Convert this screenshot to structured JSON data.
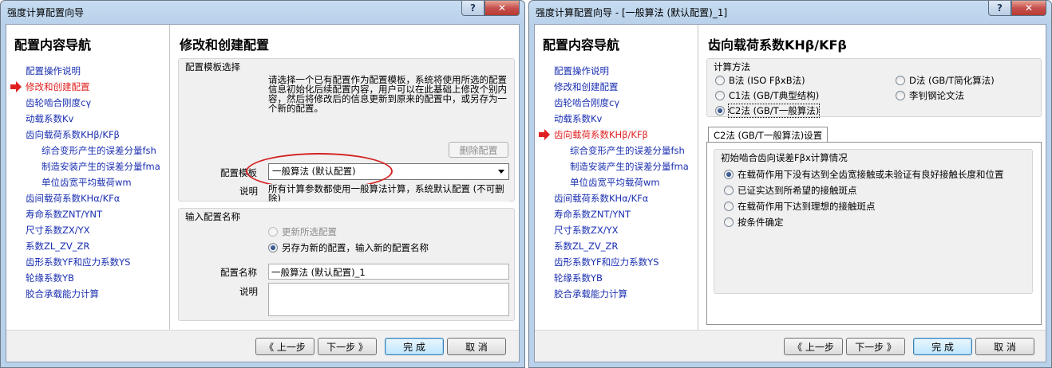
{
  "left_window": {
    "title": "强度计算配置向导",
    "nav_title": "配置内容导航",
    "nav_items": [
      {
        "label": "配置操作说明"
      },
      {
        "label": "修改和创建配置"
      },
      {
        "label": "齿轮啮合刚度cγ"
      },
      {
        "label": "动载系数Kv"
      },
      {
        "label": "齿向载荷系数KHβ/KFβ"
      },
      {
        "label": "综合变形产生的误差分量fsh"
      },
      {
        "label": "制造安装产生的误差分量fma"
      },
      {
        "label": "单位齿宽平均载荷wm"
      },
      {
        "label": "齿间载荷系数KHα/KFα"
      },
      {
        "label": "寿命系数ZNT/YNT"
      },
      {
        "label": "尺寸系数ZX/YX"
      },
      {
        "label": "系数ZL_ZV_ZR"
      },
      {
        "label": "齿形系数YF和应力系数YS"
      },
      {
        "label": "轮缘系数YB"
      },
      {
        "label": "胶合承载能力计算"
      }
    ],
    "main_title": "修改和创建配置",
    "template_group": {
      "title": "配置模板选择",
      "description": "请选择一个已有配置作为配置模板，系统将使用所选的配置信息初始化后续配置内容，用户可以在此基础上修改个别内容，然后将修改后的信息更新到原来的配置中，或另存为一个新的配置。",
      "delete_button": "删除配置",
      "template_label": "配置模板",
      "template_value": "一般算法  (默认配置)",
      "note_label": "说明",
      "note_value": "所有计算参数都使用一般算法计算，系统默认配置 (不可删除)"
    },
    "name_group": {
      "title": "输入配置名称",
      "option_update": "更新所选配置",
      "option_save_as": "另存为新的配置，输入新的配置名称",
      "name_label": "配置名称",
      "name_value": "一般算法  (默认配置)_1",
      "note_label": "说明",
      "note_value": ""
    },
    "buttons": {
      "prev": "《 上一步",
      "next": "下一步 》",
      "finish": "完 成",
      "cancel": "取 消"
    }
  },
  "right_window": {
    "title": "强度计算配置向导 - [一般算法 (默认配置)_1]",
    "nav_title": "配置内容导航",
    "nav_items": [
      {
        "label": "配置操作说明"
      },
      {
        "label": "修改和创建配置"
      },
      {
        "label": "齿轮啮合刚度cγ"
      },
      {
        "label": "动载系数Kv"
      },
      {
        "label": "齿向载荷系数KHβ/KFβ"
      },
      {
        "label": "综合变形产生的误差分量fsh"
      },
      {
        "label": "制造安装产生的误差分量fma"
      },
      {
        "label": "单位齿宽平均载荷wm"
      },
      {
        "label": "齿间载荷系数KHα/KFα"
      },
      {
        "label": "寿命系数ZNT/YNT"
      },
      {
        "label": "尺寸系数ZX/YX"
      },
      {
        "label": "系数ZL_ZV_ZR"
      },
      {
        "label": "齿形系数YF和应力系数YS"
      },
      {
        "label": "轮缘系数YB"
      },
      {
        "label": "胶合承载能力计算"
      }
    ],
    "main_title": "齿向载荷系数KHβ/KFβ",
    "method_group": {
      "title": "计算方法",
      "options": [
        "B法 (ISO FβxB法)",
        "D法 (GB/T简化算法)",
        "C1法 (GB/T典型结构)",
        "李钊钢论文法",
        "C2法 (GB/T一般算法)"
      ]
    },
    "tab_label": "C2法 (GB/T一般算法)设置",
    "contact_group": {
      "title": "初始啮合齿向误差Fβx计算情况",
      "options": [
        "在载荷作用下没有达到全齿宽接触或未验证有良好接触长度和位置",
        "已证实达到所希望的接触斑点",
        "在载荷作用下达到理想的接触斑点",
        "按条件确定"
      ]
    },
    "buttons": {
      "prev": "《 上一步",
      "next": "下一步 》",
      "finish": "完 成",
      "cancel": "取 消"
    }
  },
  "colors": {
    "nav_link": "#1a2fb0",
    "nav_active": "#e02020",
    "annotation": "#d42020"
  }
}
